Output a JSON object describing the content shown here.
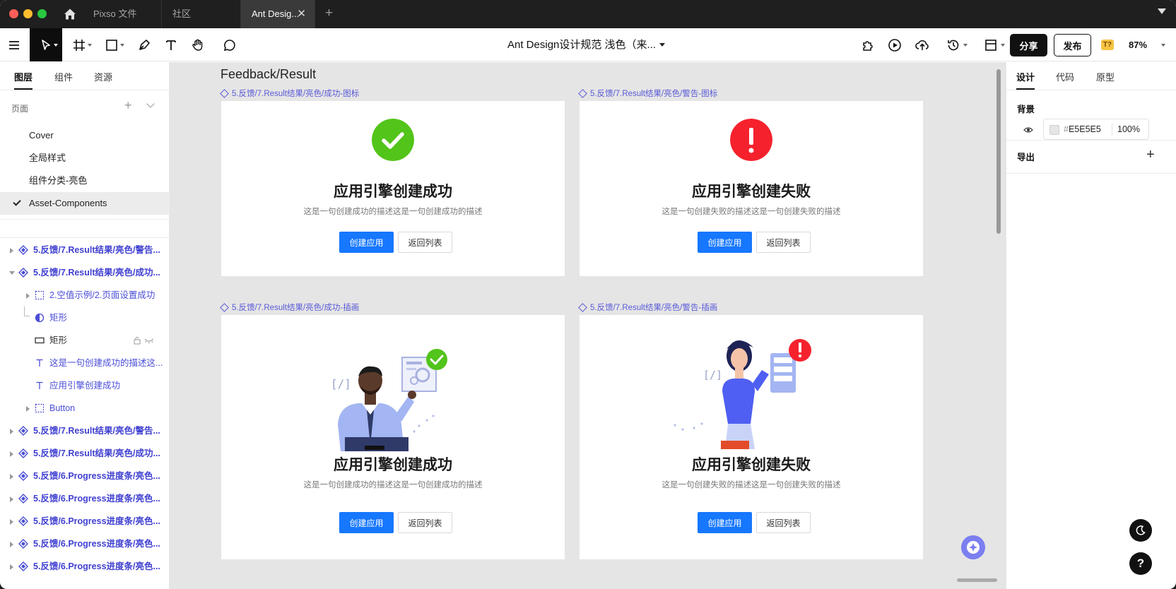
{
  "titlebar": {
    "tabs": [
      {
        "label": "Pixso 文件"
      },
      {
        "label": "社区"
      },
      {
        "label": "Ant Desig..."
      }
    ],
    "new_tab": "+"
  },
  "toolbar": {
    "doc_title": "Ant Design设计规范 浅色（来...",
    "share_label": "分享",
    "publish_label": "发布",
    "badge": "T?",
    "zoom": "87%"
  },
  "left_panel": {
    "tabs": [
      "图层",
      "组件",
      "资源"
    ],
    "active_tab": "图层",
    "pages_label": "页面",
    "pages": [
      "Cover",
      "全局样式",
      "组件分类-亮色",
      "Asset-Components"
    ],
    "selected_page": "Asset-Components",
    "layers": [
      {
        "label": "5.反馈/7.Result结果/亮色/警告...",
        "type": "component",
        "level": 0,
        "expand": "right"
      },
      {
        "label": "5.反馈/7.Result结果/亮色/成功...",
        "type": "component",
        "level": 0,
        "expand": "down"
      },
      {
        "label": "2.空值示例/2.页面设置成功",
        "type": "frame",
        "level": 1,
        "expand": "right"
      },
      {
        "label": "矩形",
        "type": "mask",
        "level": 1,
        "expand": "none"
      },
      {
        "label": "矩形",
        "type": "rect",
        "level": 1,
        "expand": "none"
      },
      {
        "label": "这是一句创建成功的描述这...",
        "type": "text",
        "level": 1,
        "expand": "none"
      },
      {
        "label": "应用引擎创建成功",
        "type": "text",
        "level": 1,
        "expand": "none"
      },
      {
        "label": "Button",
        "type": "frame",
        "level": 1,
        "expand": "right"
      },
      {
        "label": "5.反馈/7.Result结果/亮色/警告...",
        "type": "component",
        "level": 0,
        "expand": "right"
      },
      {
        "label": "5.反馈/7.Result结果/亮色/成功...",
        "type": "component",
        "level": 0,
        "expand": "right"
      },
      {
        "label": "5.反馈/6.Progress进度条/亮色...",
        "type": "component",
        "level": 0,
        "expand": "right"
      },
      {
        "label": "5.反馈/6.Progress进度条/亮色...",
        "type": "component",
        "level": 0,
        "expand": "right"
      },
      {
        "label": "5.反馈/6.Progress进度条/亮色...",
        "type": "component",
        "level": 0,
        "expand": "right"
      },
      {
        "label": "5.反馈/6.Progress进度条/亮色...",
        "type": "component",
        "level": 0,
        "expand": "right"
      },
      {
        "label": "5.反馈/6.Progress进度条/亮色...",
        "type": "component",
        "level": 0,
        "expand": "right"
      }
    ]
  },
  "canvas": {
    "frame_title": "Feedback/Result",
    "background": "#E5E5E5",
    "cards": [
      {
        "label": "5.反馈/7.Result结果/亮色/成功-图标",
        "title": "应用引擎创建成功",
        "desc": "这是一句创建成功的描述这是一句创建成功的描述",
        "primary": "创建应用",
        "secondary": "返回列表",
        "status": "success",
        "visual": "icon"
      },
      {
        "label": "5.反馈/7.Result结果/亮色/警告-图标",
        "title": "应用引擎创建失败",
        "desc": "这是一句创建失败的描述这是一句创建失败的描述",
        "primary": "创建应用",
        "secondary": "返回列表",
        "status": "error",
        "visual": "icon"
      },
      {
        "label": "5.反馈/7.Result结果/亮色/成功-插画",
        "title": "应用引擎创建成功",
        "desc": "这是一句创建成功的描述这是一句创建成功的描述",
        "primary": "创建应用",
        "secondary": "返回列表",
        "status": "success",
        "visual": "illustration"
      },
      {
        "label": "5.反馈/7.Result结果/亮色/警告-插画",
        "title": "应用引擎创建失败",
        "desc": "这是一句创建失败的描述这是一句创建失败的描述",
        "primary": "创建应用",
        "secondary": "返回列表",
        "status": "error",
        "visual": "illustration"
      }
    ],
    "colors": {
      "success": "#52C41A",
      "error": "#F5222D",
      "primary": "#1677FF"
    }
  },
  "right_panel": {
    "tabs": [
      "设计",
      "代码",
      "原型"
    ],
    "active_tab": "设计",
    "background_label": "背景",
    "bg_hash": "#",
    "bg_hex": "E5E5E5",
    "bg_opacity": "100%",
    "export_label": "导出",
    "help": "?"
  }
}
